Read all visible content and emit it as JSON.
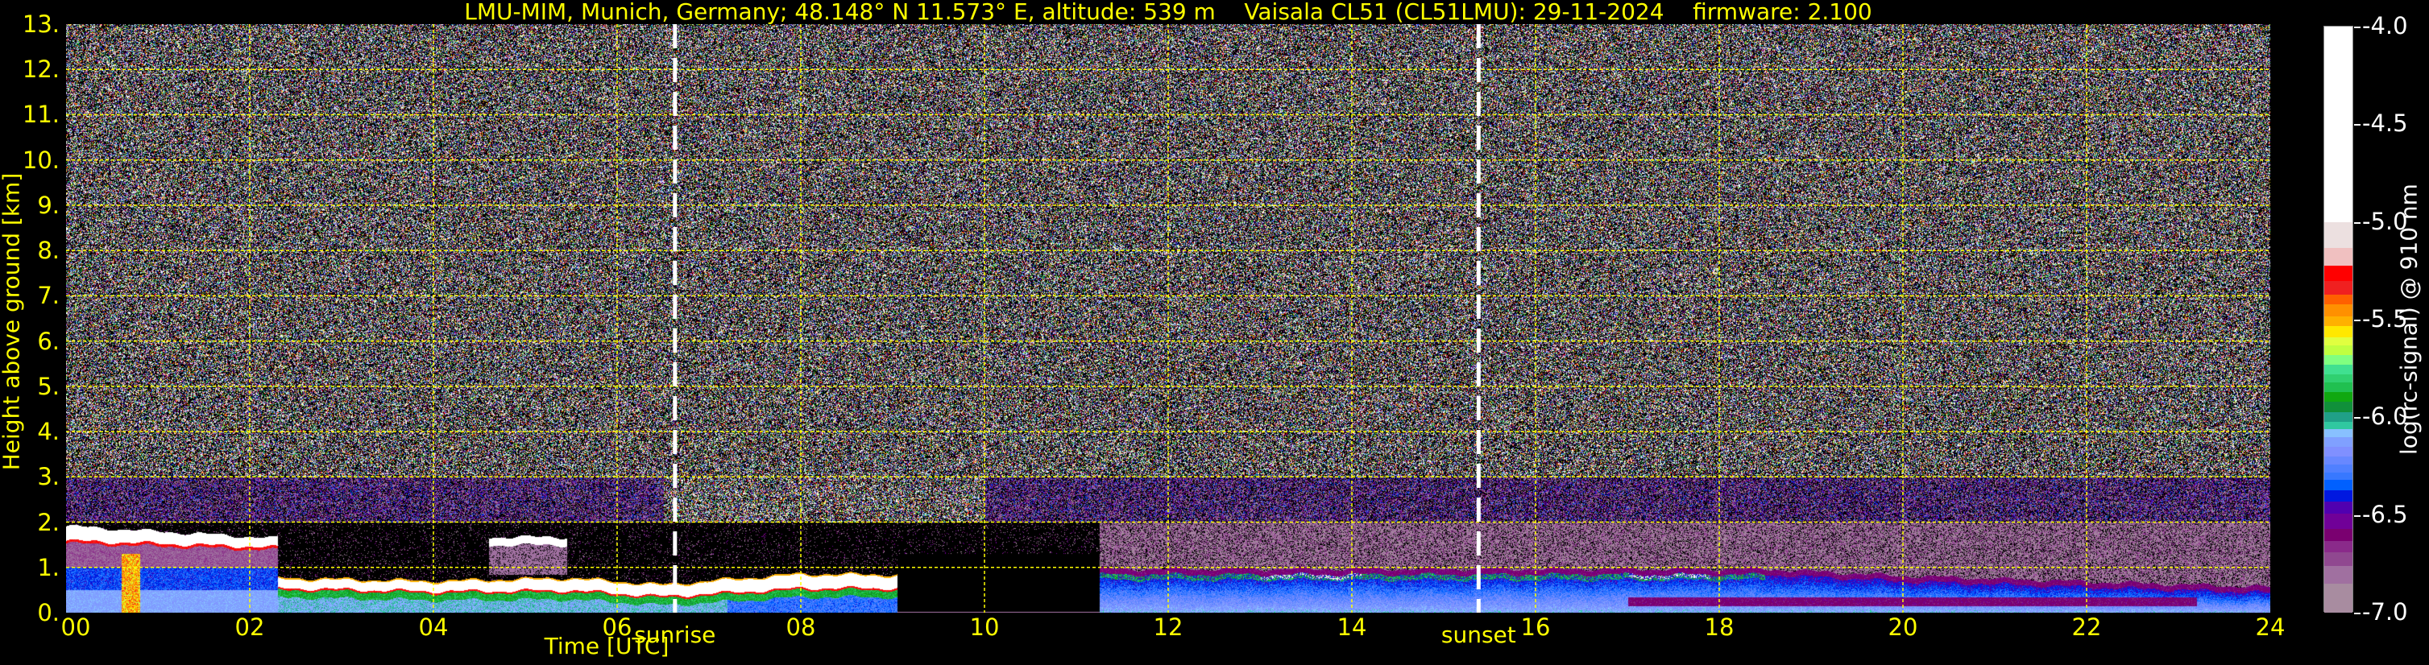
{
  "title": "LMU-MIM, Munich, Germany; 48.148° N 11.573° E, altitude: 539 m    Vaisala CL51 (CL51LMU): 29-11-2024    firmware: 2.100",
  "chart_data": {
    "type": "heatmap",
    "xlabel": "Time [UTC]",
    "ylabel": "Height above ground [km]",
    "xlim": [
      0,
      24
    ],
    "ylim": [
      0,
      13
    ],
    "xticks": [
      "00",
      "02",
      "04",
      "06",
      "08",
      "10",
      "12",
      "14",
      "16",
      "18",
      "20",
      "22",
      "24"
    ],
    "xtick_values": [
      0,
      2,
      4,
      6,
      8,
      10,
      12,
      14,
      16,
      18,
      20,
      22,
      24
    ],
    "yticks": [
      "0.",
      "1.",
      "2.",
      "3.",
      "4.",
      "5.",
      "6.",
      "7.",
      "8.",
      "9.",
      "10.",
      "11.",
      "12.",
      "13."
    ],
    "ytick_values": [
      0,
      1,
      2,
      3,
      4,
      5,
      6,
      7,
      8,
      9,
      10,
      11,
      12,
      13
    ],
    "grid": true,
    "grid_color": "#ffff00",
    "markers": [
      {
        "label": "sunrise",
        "time_utc": 6.63
      },
      {
        "label": "sunset",
        "time_utc": 15.38
      }
    ],
    "colorbar": {
      "label": "log(rc-signal) @ 910 nm",
      "range": [
        -7.0,
        -4.0
      ],
      "ticks": [
        "-4.0",
        "-4.5",
        "-5.0",
        "-5.5",
        "-6.0",
        "-6.5",
        "-7.0"
      ],
      "tick_values": [
        -4.0,
        -4.5,
        -5.0,
        -5.5,
        -6.0,
        -6.5,
        -7.0
      ],
      "levels": [
        -7.0,
        -6.85,
        -6.76,
        -6.69,
        -6.63,
        -6.57,
        -6.49,
        -6.43,
        -6.37,
        -6.32,
        -6.28,
        -6.24,
        -6.2,
        -6.15,
        -6.1,
        -6.06,
        -6.02,
        -5.97,
        -5.92,
        -5.87,
        -5.82,
        -5.78,
        -5.73,
        -5.68,
        -5.63,
        -5.59,
        -5.53,
        -5.48,
        -5.42,
        -5.37,
        -5.3,
        -5.22,
        -5.13,
        -5.0
      ],
      "colors": [
        "#a88ca0",
        "#a070a0",
        "#904890",
        "#8a2a8a",
        "#7a0070",
        "#700098",
        "#5000b0",
        "#0018e0",
        "#0060ff",
        "#3878ff",
        "#5080ff",
        "#6888ff",
        "#8090ff",
        "#80a0ff",
        "#88c0ff",
        "#30c8a0",
        "#20a088",
        "#10903a",
        "#10a810",
        "#20c050",
        "#30d070",
        "#40e090",
        "#80ff80",
        "#c0ff40",
        "#e0ff40",
        "#ffe800",
        "#ffb000",
        "#ff9000",
        "#ff6000",
        "#f02020",
        "#ff0000",
        "#f0c0c0",
        "#ece0e0",
        "#ffffff"
      ]
    },
    "cloud_layers": [
      {
        "start": 0.0,
        "end": 2.3,
        "top_km": [
          1.92,
          1.65
        ],
        "base_km": [
          1.6,
          1.45
        ]
      },
      {
        "start": 2.3,
        "end": 9.05,
        "top_km": [
          0.75,
          0.82
        ],
        "base_km": [
          0.55,
          0.55
        ]
      },
      {
        "start": 4.6,
        "end": 5.45,
        "top_km": [
          1.68,
          1.66
        ],
        "base_km": [
          1.5,
          1.5
        ]
      }
    ],
    "no_signal": {
      "start": 9.05,
      "end": 11.25,
      "below_km": 1.3
    },
    "aerosol_layer_top_km": [
      [
        11.25,
        0.85
      ],
      [
        18.5,
        0.85
      ],
      [
        20,
        0.7
      ],
      [
        24,
        0.45
      ]
    ]
  }
}
